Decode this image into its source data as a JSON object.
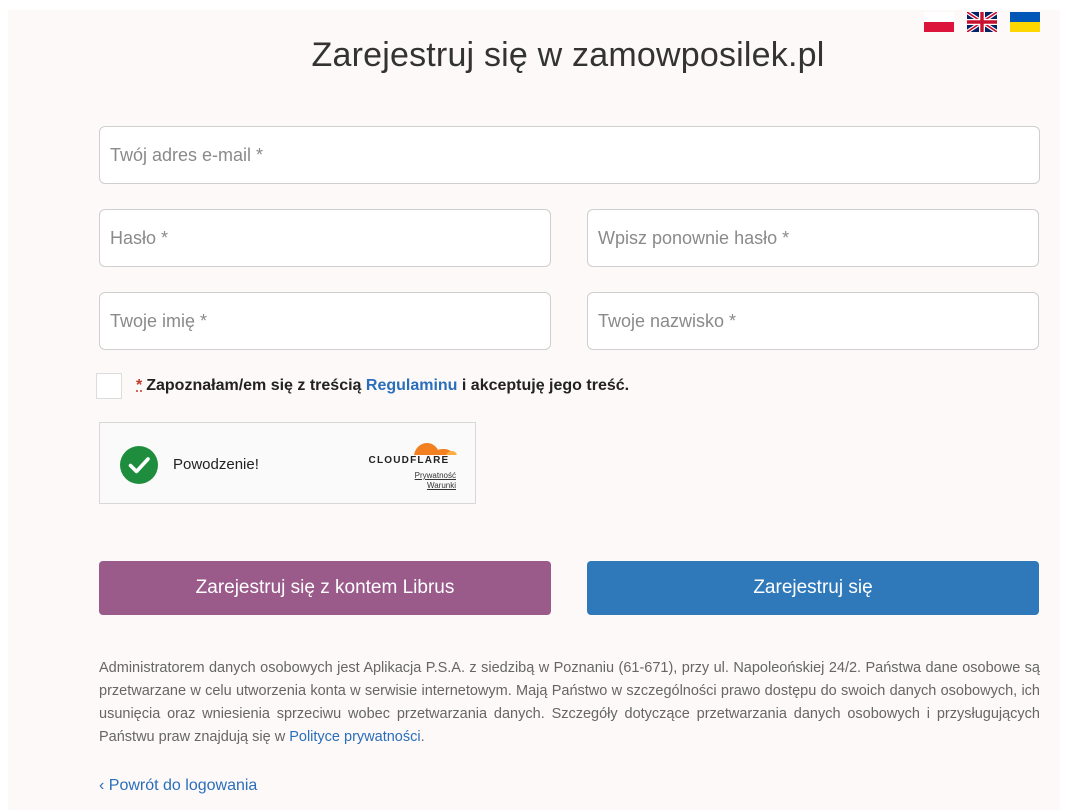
{
  "header": {
    "title": "Zarejestruj się w zamowposilek.pl",
    "languages": [
      {
        "code": "pl",
        "icon": "poland-flag-icon"
      },
      {
        "code": "en",
        "icon": "uk-flag-icon"
      },
      {
        "code": "uk",
        "icon": "ukraine-flag-icon"
      }
    ]
  },
  "form": {
    "email_placeholder": "Twój adres e-mail *",
    "password_placeholder": "Hasło *",
    "password_repeat_placeholder": "Wpisz ponownie hasło *",
    "first_name_placeholder": "Twoje imię *",
    "last_name_placeholder": "Twoje nazwisko *",
    "terms": {
      "required_mark": "*",
      "text_before": "Zapoznałam/em się z treścią ",
      "link": "Regulaminu",
      "text_after": " i akceptuję jego treść."
    }
  },
  "captcha": {
    "status": "Powodzenie!",
    "provider": "CLOUDFLARE",
    "privacy_link": "Prywatność",
    "terms_link": "Warunki"
  },
  "buttons": {
    "librus": "Zarejestruj się z kontem Librus",
    "register": "Zarejestruj się"
  },
  "privacy_notice": {
    "text": "Administratorem danych osobowych jest Aplikacja P.S.A. z siedzibą w Poznaniu (61-671), przy ul. Napoleońskiej 24/2. Państwa dane osobowe są przetwarzane w celu utworzenia konta w serwisie internetowym. Mają Państwo w szczególności prawo dostępu do swoich danych osobowych, ich usunięcia oraz wniesienia sprzeciwu wobec przetwarzania danych. Szczegóły dotyczące przetwarzania danych osobowych i przysługujących Państwu praw znajdują się w ",
    "link": "Polityce prywatności",
    "suffix": "."
  },
  "back_link": "‹ Powrót do logowania",
  "colors": {
    "background": "#fcf9f8",
    "librus_button": "#9a5a8a",
    "register_button": "#2f79bb",
    "link": "#2a6ebb",
    "success": "#1e8e3e",
    "cloudflare_orange": "#f38020"
  }
}
